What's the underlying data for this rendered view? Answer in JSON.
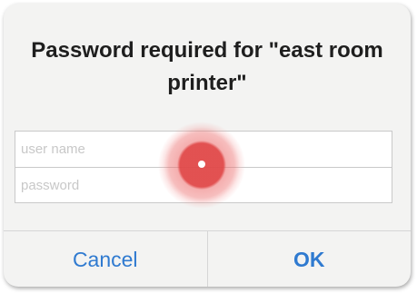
{
  "dialog": {
    "title": "Password required for \"east room printer\"",
    "username_placeholder": "user name",
    "password_placeholder": "password",
    "cancel_label": "Cancel",
    "ok_label": "OK"
  },
  "colors": {
    "button_text": "#2f7ad0",
    "touch_indicator": "#e04848",
    "dialog_background": "#f3f3f2"
  }
}
